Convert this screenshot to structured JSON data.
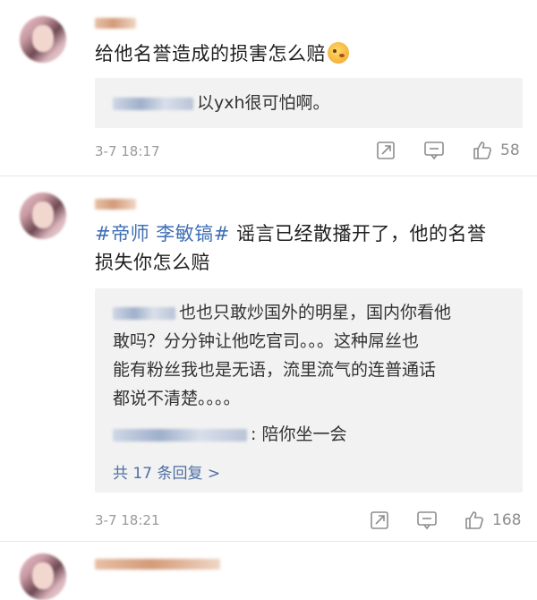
{
  "comments": [
    {
      "text": "给他名誉造成的损害怎么赔",
      "reply": {
        "text": "以yxh很可怕啊。"
      },
      "time": "3-7 18:17",
      "likes": "58"
    },
    {
      "topic": "#帝师 李敏镐#",
      "text": " 谣言已经散播开了，他的名誉",
      "text_line2": "损失你怎么赔",
      "reply": {
        "line1": "也也只敢炒国外的明星，国内你看他",
        "line2": "敢吗？分分钟让他吃官司。。。这种屌丝也",
        "line3": "能有粉丝我也是无语，流里流气的连普通话",
        "line4": "都说不清楚。。。。",
        "reply2": ": 陪你坐一会",
        "more": "共 17 条回复 >"
      },
      "time": "3-7 18:21",
      "likes": "168"
    }
  ],
  "icons": {
    "share": "share-icon",
    "comment": "comment-icon",
    "like": "like-icon",
    "emoji": "emoji-icon"
  },
  "colors": {
    "topic": "#3f6fb5",
    "reply_bg": "#f2f2f2",
    "meta": "#9a9a9a"
  }
}
